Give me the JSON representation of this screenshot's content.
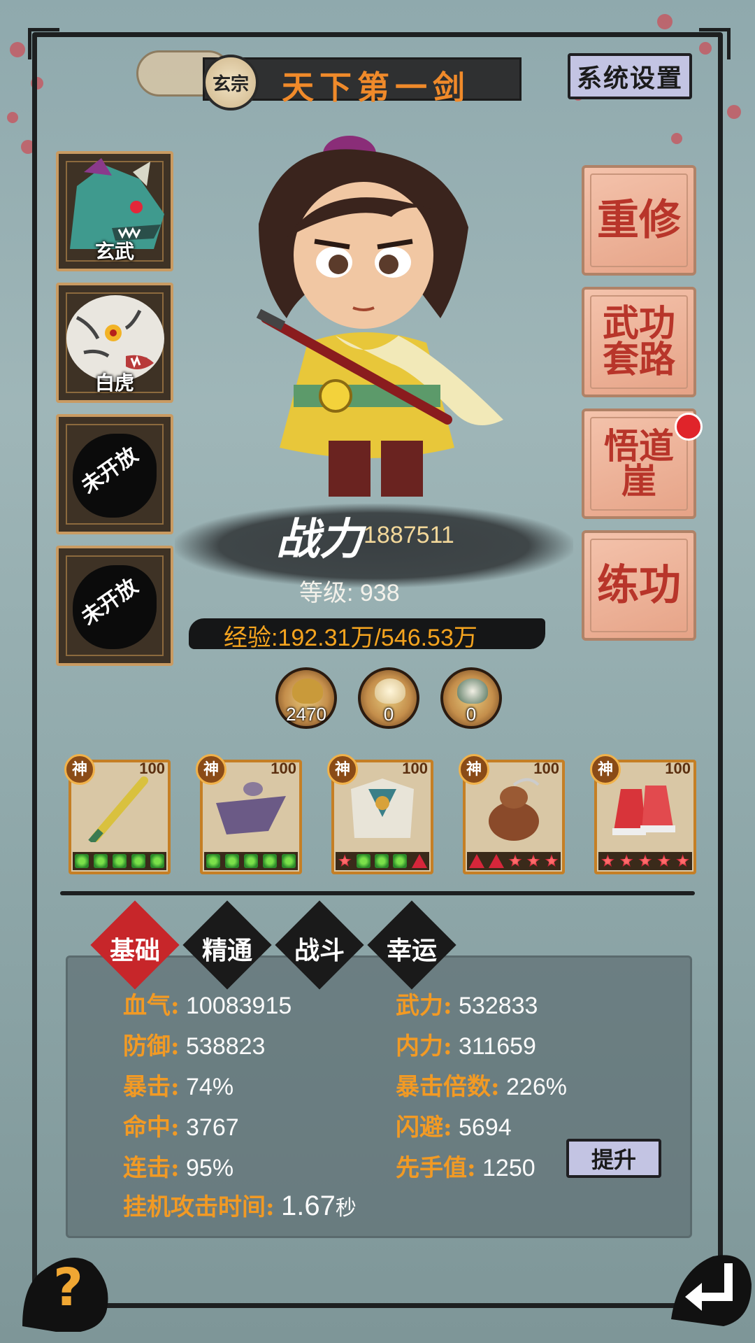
{
  "header": {
    "sect_badge": "玄宗",
    "title": "天下第一剑",
    "settings_label": "系统设置"
  },
  "beast_slots": [
    {
      "label": "玄武",
      "state": "unlocked"
    },
    {
      "label": "白虎",
      "state": "unlocked"
    },
    {
      "label": "未开放",
      "state": "locked"
    },
    {
      "label": "未开放",
      "state": "locked"
    }
  ],
  "side_buttons": [
    {
      "label": "重修"
    },
    {
      "label": "武功套路"
    },
    {
      "label": "悟道崖",
      "has_notification": true
    },
    {
      "label": "练功"
    }
  ],
  "character": {
    "power_label": "战力",
    "power_value": "1887511",
    "level_text": "等级: 938",
    "exp_text": "经验:192.31万/546.53万"
  },
  "currencies": [
    {
      "icon": "gold-ingot-icon",
      "value": "2470"
    },
    {
      "icon": "pearl-icon",
      "value": "0"
    },
    {
      "icon": "jade-urn-icon",
      "value": "0"
    }
  ],
  "equipment": [
    {
      "grade": "神",
      "level": "100",
      "icon": "sword-icon",
      "gems": [
        "g",
        "g",
        "g",
        "g",
        "g"
      ]
    },
    {
      "grade": "神",
      "level": "100",
      "icon": "hat-icon",
      "gems": [
        "g",
        "g",
        "g",
        "g",
        "g"
      ]
    },
    {
      "grade": "神",
      "level": "100",
      "icon": "armor-icon",
      "gems": [
        "s",
        "g",
        "g",
        "g",
        "t"
      ]
    },
    {
      "grade": "神",
      "level": "100",
      "icon": "gourd-icon",
      "gems": [
        "t",
        "t",
        "s",
        "s",
        "s"
      ]
    },
    {
      "grade": "神",
      "level": "100",
      "icon": "boots-icon",
      "gems": [
        "s",
        "s",
        "s",
        "s",
        "s"
      ]
    }
  ],
  "tabs": [
    {
      "label": "基础",
      "active": true
    },
    {
      "label": "精通",
      "active": false
    },
    {
      "label": "战斗",
      "active": false
    },
    {
      "label": "幸运",
      "active": false
    }
  ],
  "stats": {
    "hp": {
      "key": "血气:",
      "value": "10083915"
    },
    "force": {
      "key": "武力:",
      "value": "532833"
    },
    "defense": {
      "key": "防御:",
      "value": "538823"
    },
    "inner": {
      "key": "内力:",
      "value": "311659"
    },
    "crit": {
      "key": "暴击:",
      "value": "74%"
    },
    "crit_mult": {
      "key": "暴击倍数:",
      "value": "226%"
    },
    "hit": {
      "key": "命中:",
      "value": "3767"
    },
    "dodge": {
      "key": "闪避:",
      "value": "5694"
    },
    "combo": {
      "key": "连击:",
      "value": "95%"
    },
    "initiative": {
      "key": "先手值:",
      "value": "1250"
    },
    "idle_time": {
      "key": "挂机攻击时间:",
      "value": "1.67",
      "unit": "秒"
    }
  },
  "upgrade_label": "提升",
  "footer": {
    "help_label": "?"
  },
  "colors": {
    "accent_orange": "#f29a24",
    "ink": "#1d1f20",
    "button_pink": "#f4c3ac",
    "tab_active": "#c7262a"
  }
}
